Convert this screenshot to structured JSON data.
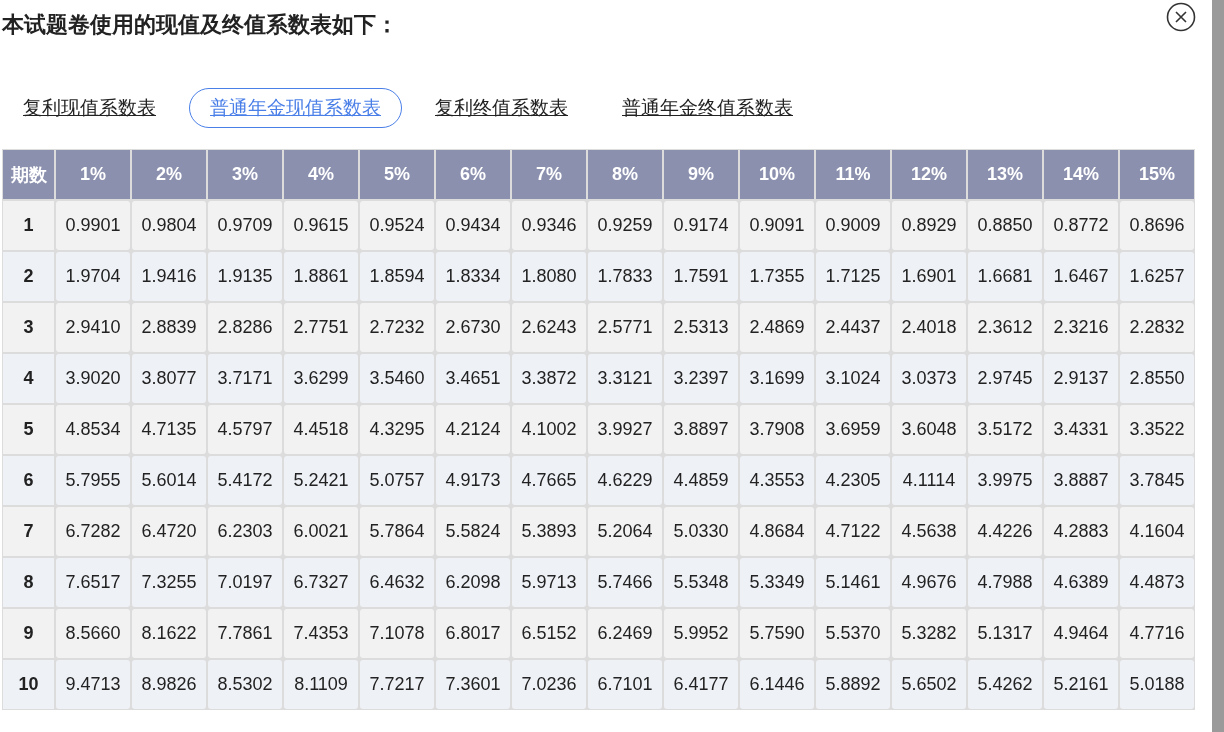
{
  "title": "本试题卷使用的现值及终值系数表如下：",
  "tabs": [
    {
      "label": "复利现值系数表",
      "selected": false
    },
    {
      "label": "普通年金现值系数表",
      "selected": true
    },
    {
      "label": "复利终值系数表",
      "selected": false
    },
    {
      "label": "普通年金终值系数表",
      "selected": false
    }
  ],
  "table": {
    "columns": [
      "期数",
      "1%",
      "2%",
      "3%",
      "4%",
      "5%",
      "6%",
      "7%",
      "8%",
      "9%",
      "10%",
      "11%",
      "12%",
      "13%",
      "14%",
      "15%"
    ],
    "rows": [
      {
        "period": "1",
        "values": [
          "0.9901",
          "0.9804",
          "0.9709",
          "0.9615",
          "0.9524",
          "0.9434",
          "0.9346",
          "0.9259",
          "0.9174",
          "0.9091",
          "0.9009",
          "0.8929",
          "0.8850",
          "0.8772",
          "0.8696"
        ]
      },
      {
        "period": "2",
        "values": [
          "1.9704",
          "1.9416",
          "1.9135",
          "1.8861",
          "1.8594",
          "1.8334",
          "1.8080",
          "1.7833",
          "1.7591",
          "1.7355",
          "1.7125",
          "1.6901",
          "1.6681",
          "1.6467",
          "1.6257"
        ]
      },
      {
        "period": "3",
        "values": [
          "2.9410",
          "2.8839",
          "2.8286",
          "2.7751",
          "2.7232",
          "2.6730",
          "2.6243",
          "2.5771",
          "2.5313",
          "2.4869",
          "2.4437",
          "2.4018",
          "2.3612",
          "2.3216",
          "2.2832"
        ]
      },
      {
        "period": "4",
        "values": [
          "3.9020",
          "3.8077",
          "3.7171",
          "3.6299",
          "3.5460",
          "3.4651",
          "3.3872",
          "3.3121",
          "3.2397",
          "3.1699",
          "3.1024",
          "3.0373",
          "2.9745",
          "2.9137",
          "2.8550"
        ]
      },
      {
        "period": "5",
        "values": [
          "4.8534",
          "4.7135",
          "4.5797",
          "4.4518",
          "4.3295",
          "4.2124",
          "4.1002",
          "3.9927",
          "3.8897",
          "3.7908",
          "3.6959",
          "3.6048",
          "3.5172",
          "3.4331",
          "3.3522"
        ]
      },
      {
        "period": "6",
        "values": [
          "5.7955",
          "5.6014",
          "5.4172",
          "5.2421",
          "5.0757",
          "4.9173",
          "4.7665",
          "4.6229",
          "4.4859",
          "4.3553",
          "4.2305",
          "4.1114",
          "3.9975",
          "3.8887",
          "3.7845"
        ]
      },
      {
        "period": "7",
        "values": [
          "6.7282",
          "6.4720",
          "6.2303",
          "6.0021",
          "5.7864",
          "5.5824",
          "5.3893",
          "5.2064",
          "5.0330",
          "4.8684",
          "4.7122",
          "4.5638",
          "4.4226",
          "4.2883",
          "4.1604"
        ]
      },
      {
        "period": "8",
        "values": [
          "7.6517",
          "7.3255",
          "7.0197",
          "6.7327",
          "6.4632",
          "6.2098",
          "5.9713",
          "5.7466",
          "5.5348",
          "5.3349",
          "5.1461",
          "4.9676",
          "4.7988",
          "4.6389",
          "4.4873"
        ]
      },
      {
        "period": "9",
        "values": [
          "8.5660",
          "8.1622",
          "7.7861",
          "7.4353",
          "7.1078",
          "6.8017",
          "6.5152",
          "6.2469",
          "5.9952",
          "5.7590",
          "5.5370",
          "5.3282",
          "5.1317",
          "4.9464",
          "4.7716"
        ]
      },
      {
        "period": "10",
        "values": [
          "9.4713",
          "8.9826",
          "8.5302",
          "8.1109",
          "7.7217",
          "7.3601",
          "7.0236",
          "6.7101",
          "6.4177",
          "6.1446",
          "5.8892",
          "5.6502",
          "5.4262",
          "5.2161",
          "5.0188"
        ]
      }
    ]
  }
}
